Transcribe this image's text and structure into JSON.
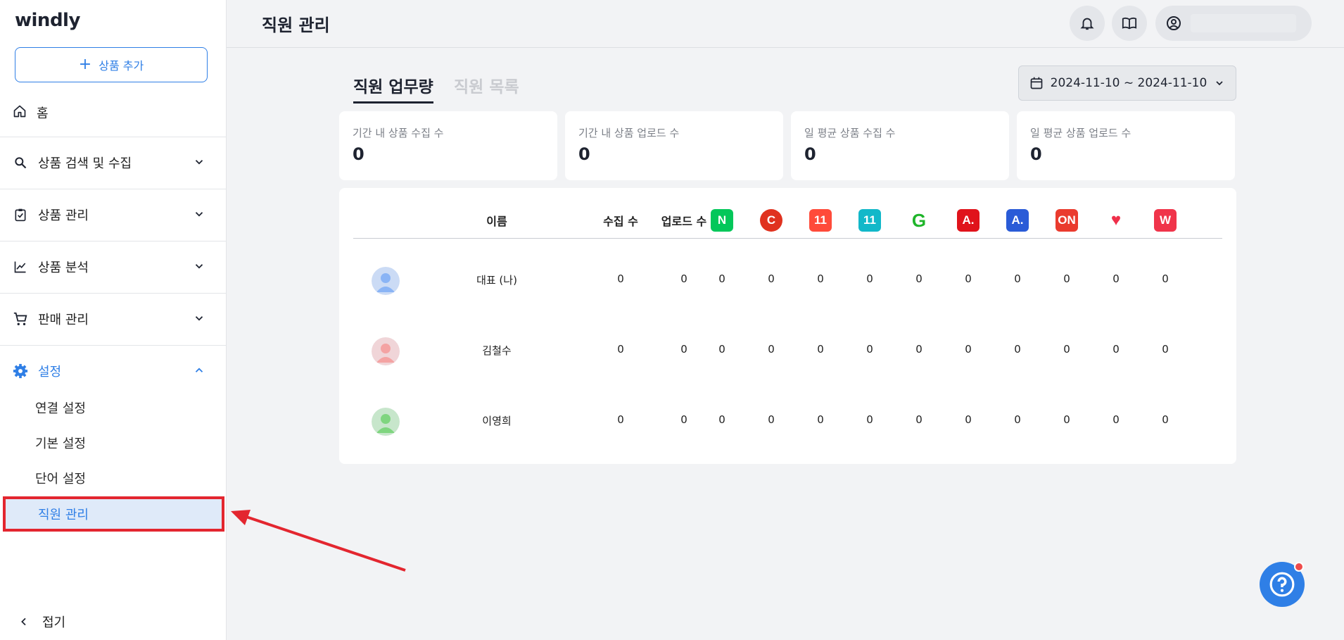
{
  "sidebar": {
    "logo": "windly",
    "add_product": "상품 추가",
    "home": "홈",
    "items": [
      {
        "label": "상품 검색 및 수집",
        "icon": "search-icon"
      },
      {
        "label": "상품 관리",
        "icon": "clipboard-check-icon"
      },
      {
        "label": "상품 분석",
        "icon": "line-chart-icon"
      },
      {
        "label": "판매 관리",
        "icon": "cart-icon"
      },
      {
        "label": "설정",
        "icon": "gear-icon"
      }
    ],
    "sub_items": [
      "연결 설정",
      "기본 설정",
      "단어 설정",
      "직원 관리"
    ],
    "collapse": "접기"
  },
  "header": {
    "title": "직원 관리"
  },
  "tabs": {
    "active": "직원 업무량",
    "inactive": "직원 목록"
  },
  "date_range": "2024-11-10 ~ 2024-11-10",
  "stats": [
    {
      "label": "기간 내 상품 수집 수",
      "value": "0"
    },
    {
      "label": "기간 내 상품 업로드 수",
      "value": "0"
    },
    {
      "label": "일 평균 상품 수집 수",
      "value": "0"
    },
    {
      "label": "일 평균 상품 업로드 수",
      "value": "0"
    }
  ],
  "table": {
    "headers": {
      "name": "이름",
      "collected": "수집 수",
      "uploaded": "업로드 수"
    },
    "markets": [
      {
        "glyph": "N",
        "color": "#03c75a"
      },
      {
        "glyph": "C",
        "color": "#e0321f"
      },
      {
        "glyph": "11",
        "color": "#ff4b3a"
      },
      {
        "glyph": "11",
        "color": "#12b8c9"
      },
      {
        "glyph": "G",
        "color": "#ffffff"
      },
      {
        "glyph": "A.",
        "color": "#e0131b"
      },
      {
        "glyph": "A.",
        "color": "#2a5bd7"
      },
      {
        "glyph": "ON",
        "color": "#ea3b2e"
      },
      {
        "glyph": "♥",
        "color": "#ffffff"
      },
      {
        "glyph": "W",
        "color": "#f0344a"
      }
    ],
    "rows": [
      {
        "name": "대표 (나)",
        "avatar_color": "#8ab4f5",
        "values": [
          "0",
          "0",
          "0",
          "0",
          "0",
          "0",
          "0",
          "0",
          "0",
          "0",
          "0",
          "0"
        ]
      },
      {
        "name": "김철수",
        "avatar_color": "#f4a3a3",
        "values": [
          "0",
          "0",
          "0",
          "0",
          "0",
          "0",
          "0",
          "0",
          "0",
          "0",
          "0",
          "0"
        ]
      },
      {
        "name": "이영희",
        "avatar_color": "#7fd57f",
        "values": [
          "0",
          "0",
          "0",
          "0",
          "0",
          "0",
          "0",
          "0",
          "0",
          "0",
          "0",
          "0"
        ]
      }
    ]
  }
}
